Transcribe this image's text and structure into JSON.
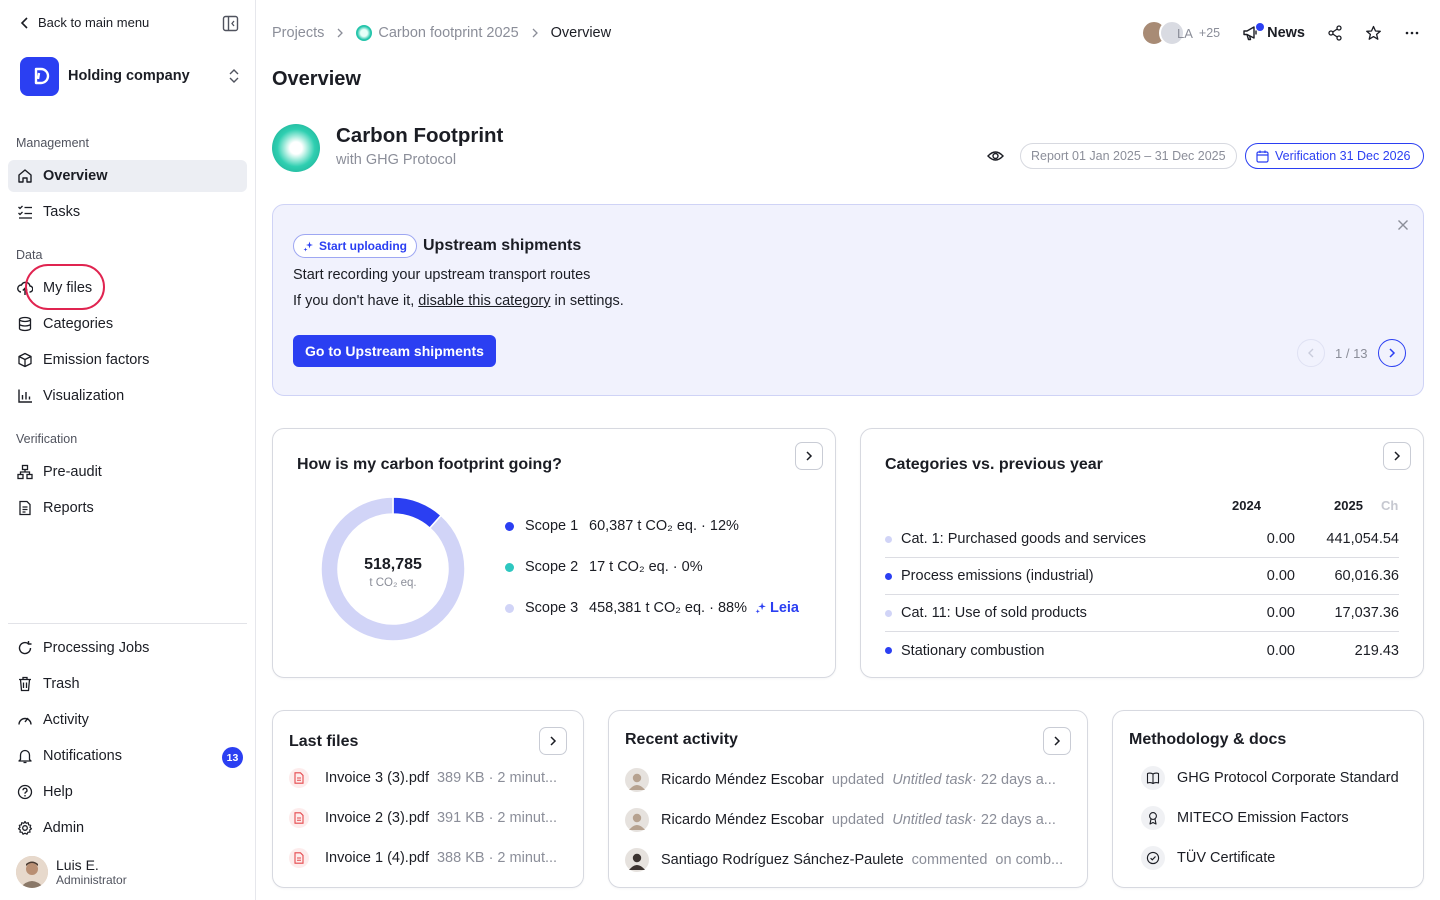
{
  "sidebar": {
    "back_label": "Back to main menu",
    "org_name": "Holding company",
    "sections": {
      "management": "Management",
      "data": "Data",
      "verification": "Verification"
    },
    "items": {
      "overview": "Overview",
      "tasks": "Tasks",
      "my_files": "My files",
      "categories": "Categories",
      "emission_factors": "Emission factors",
      "visualization": "Visualization",
      "pre_audit": "Pre-audit",
      "reports": "Reports",
      "processing_jobs": "Processing Jobs",
      "trash": "Trash",
      "activity": "Activity",
      "notifications": "Notifications",
      "help": "Help",
      "admin": "Admin"
    },
    "notifications_count": "13",
    "user": {
      "name": "Luis E.",
      "role": "Administrator"
    }
  },
  "header": {
    "breadcrumb": {
      "projects": "Projects",
      "project": "Carbon footprint 2025",
      "current": "Overview"
    },
    "avatar_initials": "LA",
    "avatar_more": "+25",
    "news_label": "News",
    "page_title": "Overview"
  },
  "project": {
    "title": "Carbon Footprint",
    "subtitle": "with GHG Protocol",
    "report_period": "Report 01 Jan 2025 – 31 Dec 2025",
    "verification": "Verification 31 Dec 2026"
  },
  "banner": {
    "tag": "Start uploading",
    "title": "Upstream shipments",
    "line1": "Start recording your upstream transport routes",
    "line2_before": "If you don't have it, ",
    "line2_link": "disable this category",
    "line2_after": " in settings.",
    "cta": "Go to Upstream shipments",
    "pager": "1 / 13"
  },
  "footprint_card": {
    "title": "How is my carbon footprint going?",
    "total": "518,785",
    "unit": "t CO₂ eq.",
    "leia_label": "Leia",
    "chart_data": {
      "type": "pie",
      "categories": [
        "Scope 1",
        "Scope 2",
        "Scope 3"
      ],
      "values": [
        60387,
        17,
        458381
      ],
      "colors": [
        "#2b3ff2",
        "#2ec7c0",
        "#d1d4f7"
      ]
    },
    "scopes": [
      {
        "name": "Scope 1",
        "value": "60,387 t CO₂ eq. · 12%",
        "color": "#2b3ff2"
      },
      {
        "name": "Scope 2",
        "value": "17 t CO₂ eq. · 0%",
        "color": "#2ec7c0"
      },
      {
        "name": "Scope 3",
        "value": "458,381 t CO₂ eq. · 88%",
        "color": "#d1d4f7"
      }
    ]
  },
  "categories_card": {
    "title": "Categories vs. previous year",
    "col_2024": "2024",
    "col_2025": "2025",
    "col_change": "Ch",
    "rows": [
      {
        "name": "Cat. 1: Purchased goods and services",
        "v2024": "0.00",
        "v2025": "441,054.54",
        "color": "#d1d4f7"
      },
      {
        "name": "Process emissions (industrial)",
        "v2024": "0.00",
        "v2025": "60,016.36",
        "color": "#2b3ff2"
      },
      {
        "name": "Cat. 11: Use of sold products",
        "v2024": "0.00",
        "v2025": "17,037.36",
        "color": "#d1d4f7"
      },
      {
        "name": "Stationary combustion",
        "v2024": "0.00",
        "v2025": "219.43",
        "color": "#2b3ff2"
      }
    ]
  },
  "files_card": {
    "title": "Last files",
    "files": [
      {
        "name": "Invoice 3 (3).pdf",
        "meta": "389 KB · 2 minut..."
      },
      {
        "name": "Invoice 2 (3).pdf",
        "meta": "391 KB · 2 minut..."
      },
      {
        "name": "Invoice 1 (4).pdf",
        "meta": "388 KB · 2 minut..."
      }
    ]
  },
  "activity_card": {
    "title": "Recent activity",
    "items": [
      {
        "user": "Ricardo Méndez Escobar",
        "action": "updated",
        "target": "Untitled task",
        "meta": " · 22 days a..."
      },
      {
        "user": "Ricardo Méndez Escobar",
        "action": "updated",
        "target": "Untitled task",
        "meta": " · 22 days a..."
      },
      {
        "user": "Santiago Rodríguez Sánchez-Paulete",
        "action": "commented",
        "target": "",
        "meta": "on comb..."
      }
    ]
  },
  "docs_card": {
    "title": "Methodology & docs",
    "docs": [
      {
        "name": "GHG Protocol Corporate Standard",
        "icon": "book-icon"
      },
      {
        "name": "MITECO Emission Factors",
        "icon": "award-icon"
      },
      {
        "name": "TÜV Certificate",
        "icon": "check-circle-icon"
      }
    ]
  }
}
